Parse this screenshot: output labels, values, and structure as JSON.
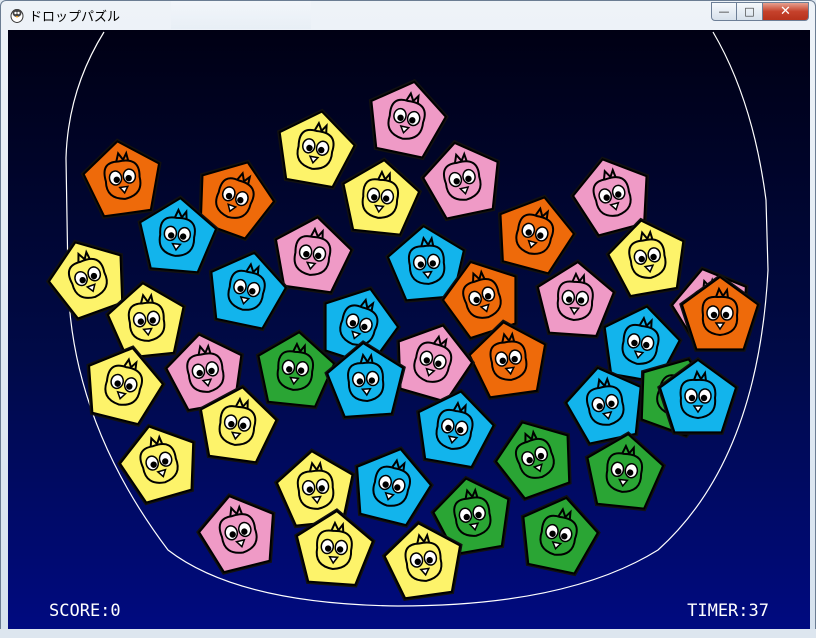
{
  "window": {
    "title": "ドロップパズル",
    "controls": {
      "minimize": "—",
      "maximize": "□",
      "close": "✕"
    }
  },
  "hud": {
    "score_label": "SCORE:0",
    "timer_label": "TIMER:37"
  },
  "palette": {
    "orange": "#ee6a0a",
    "blue": "#12b4ec",
    "yellow": "#fdf36a",
    "pink": "#ef9ac6",
    "green": "#2aa534",
    "bowl_line": "#ffffff"
  },
  "pieces": [
    {
      "color": "pink"
    },
    {
      "color": "orange"
    },
    {
      "color": "yellow"
    },
    {
      "color": "pink"
    },
    {
      "color": "yellow"
    },
    {
      "color": "orange"
    },
    {
      "color": "pink"
    },
    {
      "color": "blue"
    },
    {
      "color": "yellow"
    },
    {
      "color": "pink"
    },
    {
      "color": "orange"
    },
    {
      "color": "blue"
    },
    {
      "color": "yellow"
    },
    {
      "color": "blue"
    },
    {
      "color": "orange"
    },
    {
      "color": "pink"
    },
    {
      "color": "blue"
    },
    {
      "color": "yellow"
    },
    {
      "color": "pink"
    },
    {
      "color": "blue"
    },
    {
      "color": "orange"
    },
    {
      "color": "pink"
    },
    {
      "color": "orange"
    },
    {
      "color": "yellow"
    },
    {
      "color": "pink"
    },
    {
      "color": "green"
    },
    {
      "color": "blue"
    },
    {
      "color": "blue"
    },
    {
      "color": "blue"
    },
    {
      "color": "green"
    },
    {
      "color": "yellow"
    },
    {
      "color": "yellow"
    },
    {
      "color": "yellow"
    },
    {
      "color": "blue"
    },
    {
      "color": "green"
    },
    {
      "color": "green"
    },
    {
      "color": "green"
    },
    {
      "color": "green"
    },
    {
      "color": "pink"
    },
    {
      "color": "yellow"
    },
    {
      "color": "yellow"
    },
    {
      "color": "blue"
    }
  ]
}
